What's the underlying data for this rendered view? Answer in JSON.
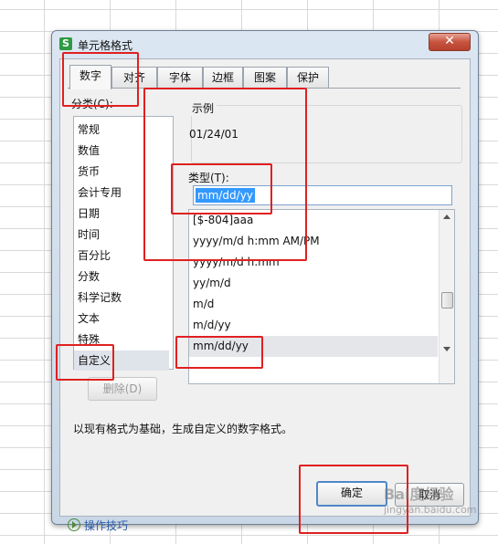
{
  "window": {
    "title": "单元格格式",
    "app_icon": "S",
    "close_symbol": "✕"
  },
  "tabs": [
    {
      "label": "数字",
      "active": true
    },
    {
      "label": "对齐",
      "active": false
    },
    {
      "label": "字体",
      "active": false
    },
    {
      "label": "边框",
      "active": false
    },
    {
      "label": "图案",
      "active": false
    },
    {
      "label": "保护",
      "active": false
    }
  ],
  "category": {
    "label": "分类(C):",
    "items": [
      "常规",
      "数值",
      "货币",
      "会计专用",
      "日期",
      "时间",
      "百分比",
      "分数",
      "科学记数",
      "文本",
      "特殊",
      "自定义"
    ],
    "selected": "自定义"
  },
  "sample": {
    "label": "示例",
    "value": "01/24/01"
  },
  "type_field": {
    "label": "类型(T):",
    "value": "mm/dd/yy"
  },
  "formats": [
    "[$-804]aaa",
    "yyyy/m/d h:mm AM/PM",
    "yyyy/m/d h:mm",
    "yy/m/d",
    "m/d",
    "m/d/yy",
    "mm/dd/yy"
  ],
  "selected_format": "mm/dd/yy",
  "buttons": {
    "delete": "删除(D)",
    "ok": "确定",
    "cancel": "取消"
  },
  "description": "以现有格式为基础，生成自定义的数字格式。",
  "tips": "操作技巧",
  "watermark": {
    "line1": "Bai度经验",
    "line2": "jingyan.baidu.com"
  },
  "colors": {
    "highlight": "#e02020",
    "selection": "#3399ff"
  }
}
